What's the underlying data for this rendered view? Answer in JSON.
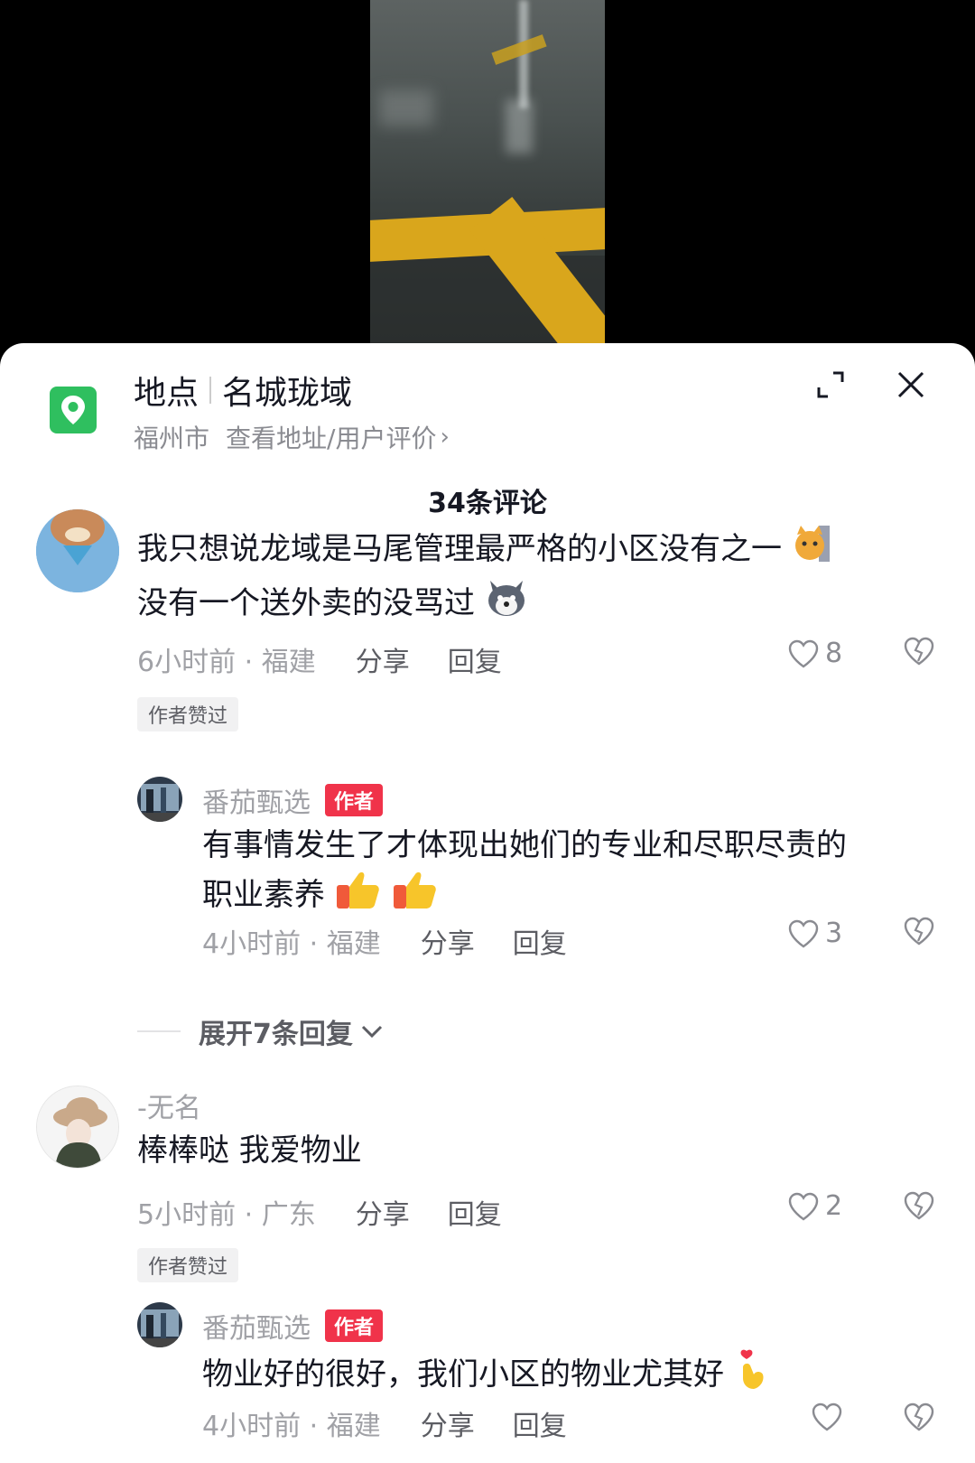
{
  "poi": {
    "label": "地点",
    "name": "名城珑域",
    "city": "福州市",
    "link": "查看地址/用户评价",
    "chevron": "›"
  },
  "comments_header": "34条评论",
  "comments": [
    {
      "text_line1": "我只想说龙域是马尾管理最严格的小区没有之一",
      "text_line2": "没有一个送外卖的没骂过",
      "time_location": "6小时前 · 福建",
      "share": "分享",
      "reply": "回复",
      "likes": "8",
      "liked_by_author_tag": "作者赞过",
      "author_reply": {
        "username": "番茄甄选",
        "badge": "作者",
        "text_line1": "有事情发生了才体现出她们的专业和尽职尽责的",
        "text_line2": "职业素养",
        "time_location": "4小时前 · 福建",
        "share": "分享",
        "reply": "回复",
        "likes": "3"
      },
      "expand_label": "展开7条回复"
    },
    {
      "username": "-无名",
      "text": "棒棒哒 我爱物业",
      "time_location": "5小时前 · 广东",
      "share": "分享",
      "reply": "回复",
      "likes": "2",
      "liked_by_author_tag": "作者赞过",
      "author_reply": {
        "username": "番茄甄选",
        "badge": "作者",
        "text": "物业好的很好，我们小区的物业尤其好",
        "time_location": "4小时前 · 福建",
        "share": "分享",
        "reply": "回复",
        "likes": ""
      }
    }
  ],
  "colors": {
    "author_badge": "#f0334a",
    "poi_icon": "#2fbf5f"
  }
}
